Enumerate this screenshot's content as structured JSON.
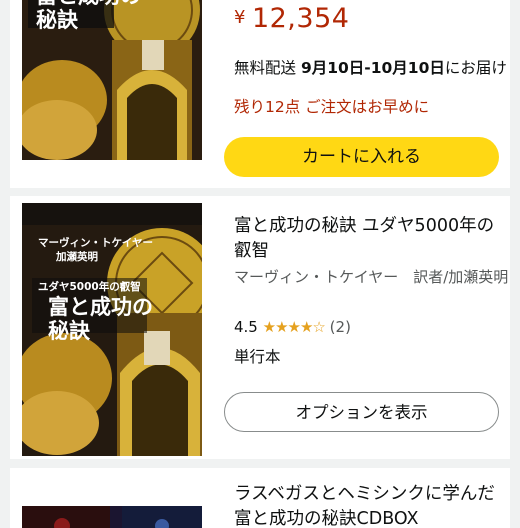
{
  "items": [
    {
      "price": "12,354",
      "currency": "¥",
      "delivery_prefix": "無料配送 ",
      "delivery_dates": "9月10日-10月10日",
      "delivery_suffix": "にお届け",
      "stock": "残り12点 ご注文はお早めに",
      "cart_button": "カートに入れる",
      "cover_title": "富と成功の\n秘訣"
    },
    {
      "title": "富と成功の秘訣 ユダヤ5000年の叡智",
      "author": "マーヴィン・トケイヤー　訳者/加瀬英明",
      "rating": "4.5",
      "stars": "★★★★☆",
      "review_count": "(2)",
      "format": "単行本",
      "options_button": "オプションを表示",
      "cover_author_1": "マーヴィン・トケイヤー",
      "cover_author_2": "加瀬英明",
      "cover_subtitle": "ユダヤ5000年の叡智",
      "cover_title": "富と成功の\n秘訣"
    },
    {
      "title": "ラスベガスとヘミシンクに学んだ富と成功の秘訣CDBOX"
    }
  ],
  "colors": {
    "price": "#b12704",
    "cart_button": "#ffd814",
    "star": "#e5a11f"
  }
}
